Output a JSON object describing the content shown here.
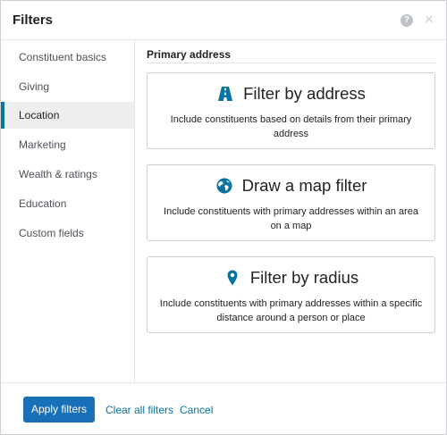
{
  "dialog": {
    "title": "Filters",
    "help_icon": "help-circle-icon",
    "close_icon": "close-icon"
  },
  "sidebar": {
    "items": [
      {
        "label": "Constituent basics",
        "active": false
      },
      {
        "label": "Giving",
        "active": false
      },
      {
        "label": "Location",
        "active": true
      },
      {
        "label": "Marketing",
        "active": false
      },
      {
        "label": "Wealth & ratings",
        "active": false
      },
      {
        "label": "Education",
        "active": false
      },
      {
        "label": "Custom fields",
        "active": false
      }
    ]
  },
  "main": {
    "section_title": "Primary address",
    "cards": [
      {
        "icon": "road-icon",
        "title": "Filter by address",
        "description": "Include constituents based on details from their primary address"
      },
      {
        "icon": "globe-icon",
        "title": "Draw a map filter",
        "description": "Include constituents with primary addresses within an area on a map"
      },
      {
        "icon": "map-pin-icon",
        "title": "Filter by radius",
        "description": "Include constituents with primary addresses within a specific distance around a person or place"
      }
    ]
  },
  "footer": {
    "apply_label": "Apply filters",
    "clear_label": "Clear all filters",
    "cancel_label": "Cancel"
  },
  "colors": {
    "accent": "#0974a1",
    "primary_button": "#1870b8",
    "active_nav_bg": "#eeeeef",
    "border": "#cdcfd2"
  }
}
